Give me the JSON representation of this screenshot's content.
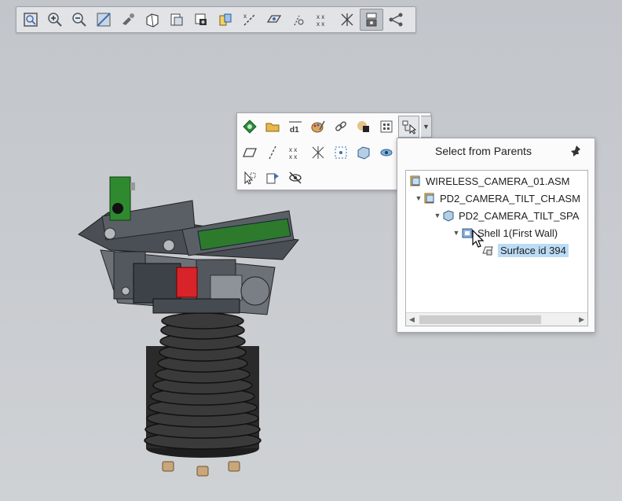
{
  "top_toolbar": {
    "buttons": [
      {
        "icon": "refit-icon"
      },
      {
        "icon": "zoom-in-icon"
      },
      {
        "icon": "zoom-out-icon"
      },
      {
        "icon": "repaint-icon"
      },
      {
        "icon": "spin-center-icon"
      },
      {
        "icon": "display-style-icon"
      },
      {
        "icon": "saved-orientations-icon"
      },
      {
        "icon": "view-manager-icon"
      },
      {
        "icon": "datum-display-icon"
      },
      {
        "icon": "axis-display-icon"
      },
      {
        "icon": "plane-display-icon"
      },
      {
        "icon": "point-display-icon"
      },
      {
        "icon": "csys-display-icon"
      },
      {
        "icon": "annotation-display-icon"
      },
      {
        "icon": "select-filter-icon",
        "active": true
      },
      {
        "icon": "connections-icon"
      }
    ]
  },
  "mini_toolbar": {
    "row1": [
      "define-feature-icon",
      "open-icon",
      "dimension-icon",
      "appearance-icon",
      "link-icon",
      "shade-icon",
      "grid-icon",
      "select-parents-icon"
    ],
    "row2": [
      "plane-icon",
      "axis-icon",
      "point-icon",
      "csys-icon",
      "grid-snap-icon",
      "box-icon",
      "hide-icon"
    ],
    "row3": [
      "zoom-selected-icon",
      "orient-icon",
      "hide-eye-icon"
    ]
  },
  "parents_panel": {
    "title": "Select from Parents",
    "tree": [
      {
        "label": "WIRELESS_CAMERA_01.ASM",
        "level": 0,
        "twisty": "",
        "icon": "assembly"
      },
      {
        "label": "PD2_CAMERA_TILT_CH.ASM",
        "level": 1,
        "twisty": "▼",
        "icon": "assembly"
      },
      {
        "label": "PD2_CAMERA_TILT_SPA",
        "level": 2,
        "twisty": "▼",
        "icon": "part"
      },
      {
        "label": "Shell 1(First Wall)",
        "level": 3,
        "twisty": "▼",
        "icon": "feature"
      },
      {
        "label": "Surface id 394",
        "level": 4,
        "twisty": "",
        "icon": "surface",
        "selected": true
      }
    ]
  },
  "colors": {
    "background": "#c7cbd0",
    "accent_green": "#2d7a2d",
    "red_part": "#d8232a",
    "selection": "#bcdcf5"
  }
}
